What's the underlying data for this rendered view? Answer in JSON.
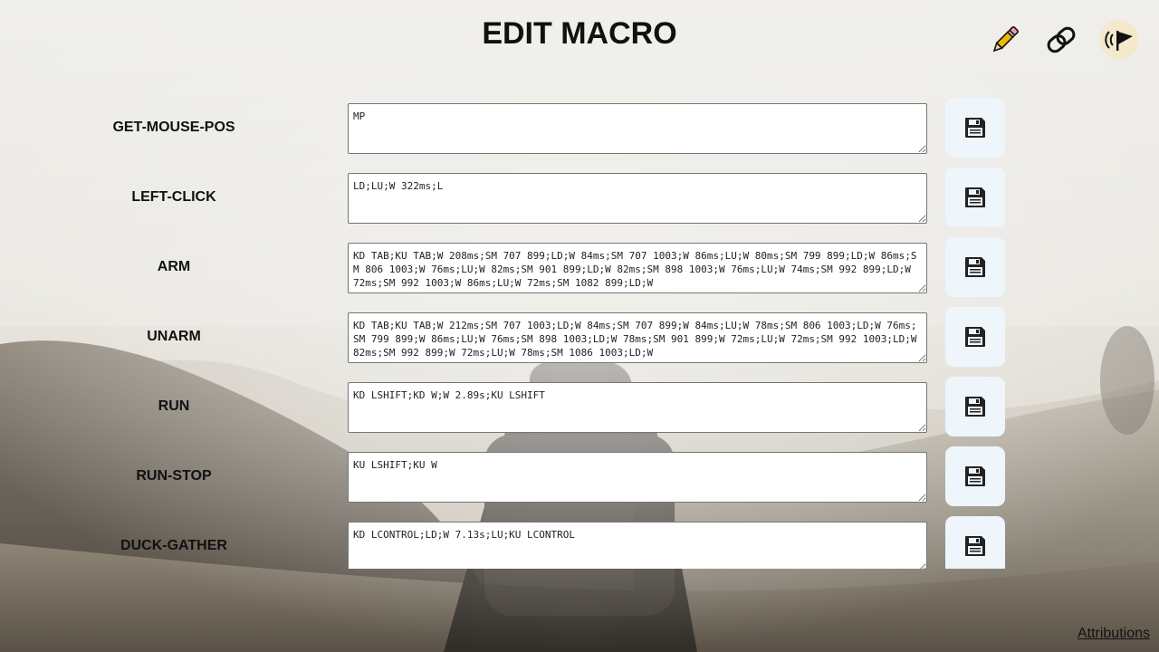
{
  "header": {
    "title": "EDIT MACRO",
    "icons": [
      "pencil-icon",
      "link-icon",
      "broadcast-flag-icon"
    ]
  },
  "macros": [
    {
      "name": "GET-MOUSE-POS",
      "value": "MP"
    },
    {
      "name": "LEFT-CLICK",
      "value": "LD;LU;W 322ms;L"
    },
    {
      "name": "ARM",
      "value": "KD TAB;KU TAB;W 208ms;SM 707 899;LD;W 84ms;SM 707 1003;W 86ms;LU;W 80ms;SM 799 899;LD;W 86ms;SM 806 1003;W 76ms;LU;W 82ms;SM 901 899;LD;W 82ms;SM 898 1003;W 76ms;LU;W 74ms;SM 992 899;LD;W 72ms;SM 992 1003;W 86ms;LU;W 72ms;SM 1082 899;LD;W"
    },
    {
      "name": "UNARM",
      "value": "KD TAB;KU TAB;W 212ms;SM 707 1003;LD;W 84ms;SM 707 899;W 84ms;LU;W 78ms;SM 806 1003;LD;W 76ms;SM 799 899;W 86ms;LU;W 76ms;SM 898 1003;LD;W 78ms;SM 901 899;W 72ms;LU;W 72ms;SM 992 1003;LD;W 82ms;SM 992 899;W 72ms;LU;W 78ms;SM 1086 1003;LD;W"
    },
    {
      "name": "RUN",
      "value": "KD LSHIFT;KD W;W 2.89s;KU LSHIFT"
    },
    {
      "name": "RUN-STOP",
      "value": "KU LSHIFT;KU W"
    },
    {
      "name": "DUCK-GATHER",
      "value": "KD LCONTROL;LD;W 7.13s;LU;KU LCONTROL"
    }
  ],
  "footer": {
    "attributions_label": "Attributions"
  },
  "colors": {
    "save_button_bg": "#eef5fb",
    "active_icon_bg": "#f5e8c8",
    "pencil_yellow": "#f2b705"
  }
}
